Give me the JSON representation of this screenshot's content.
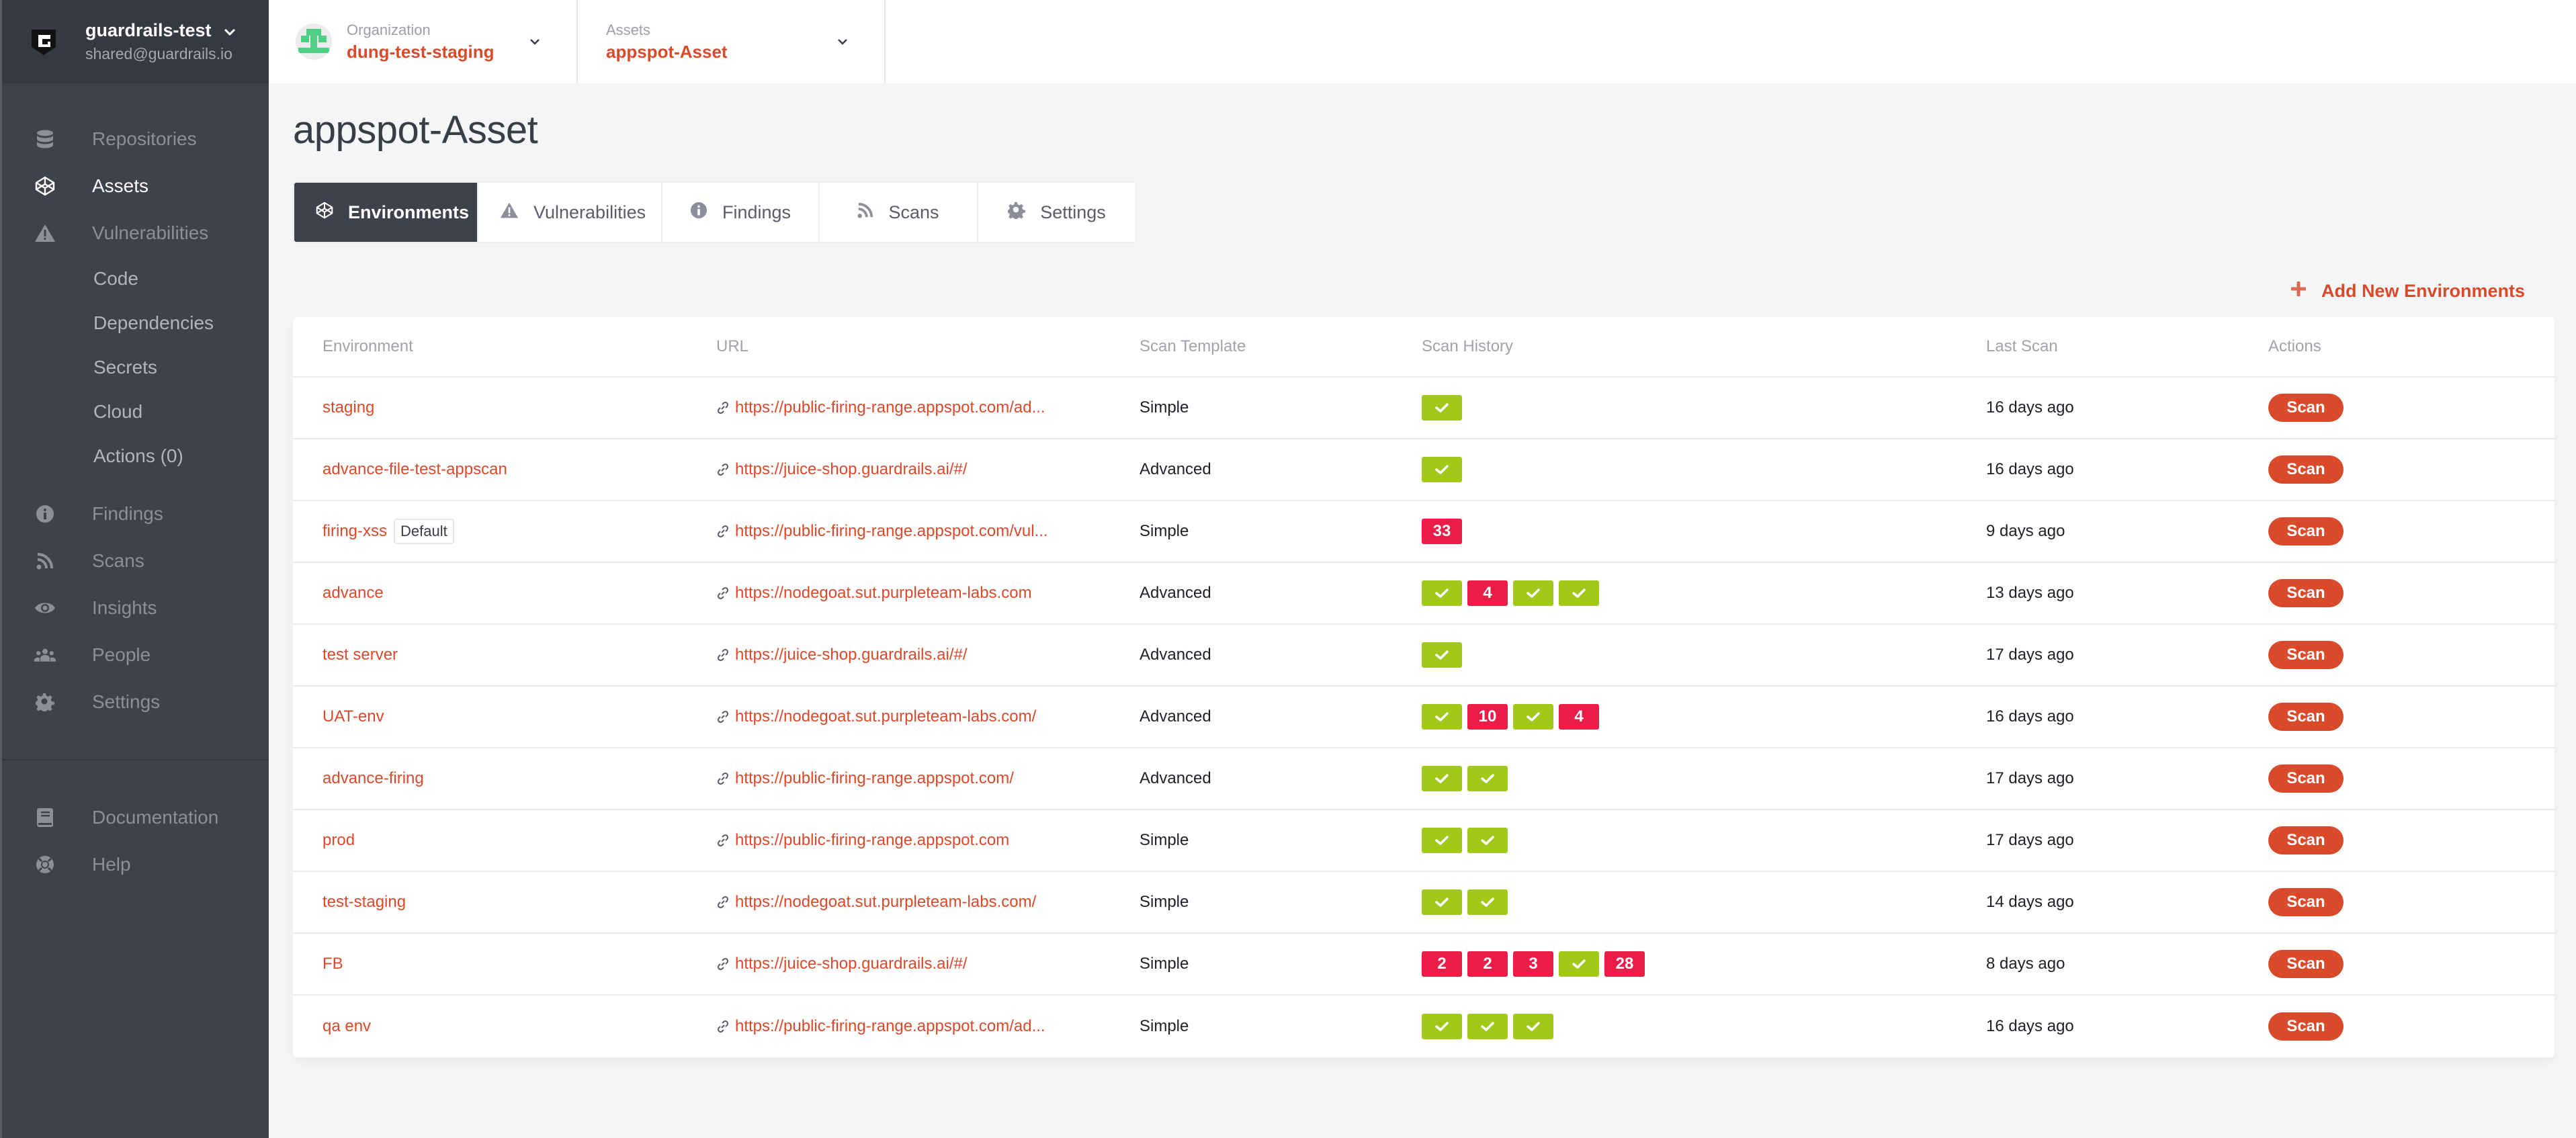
{
  "account": {
    "name": "guardrails-test",
    "email": "shared@guardrails.io"
  },
  "sidebar": {
    "items": [
      {
        "label": "Repositories",
        "icon": "database-icon",
        "active": false
      },
      {
        "label": "Assets",
        "icon": "cube-icon",
        "active": true
      },
      {
        "label": "Vulnerabilities",
        "icon": "warning-icon",
        "active": false
      }
    ],
    "subitems": [
      "Code",
      "Dependencies",
      "Secrets",
      "Cloud",
      "Actions (0)"
    ],
    "items2": [
      {
        "label": "Findings",
        "icon": "info-icon"
      },
      {
        "label": "Scans",
        "icon": "rss-icon"
      },
      {
        "label": "Insights",
        "icon": "eye-icon"
      },
      {
        "label": "People",
        "icon": "users-icon"
      },
      {
        "label": "Settings",
        "icon": "gear-icon"
      }
    ],
    "footer": [
      {
        "label": "Documentation",
        "icon": "book-icon"
      },
      {
        "label": "Help",
        "icon": "lifebuoy-icon"
      }
    ]
  },
  "topbar": {
    "organization": {
      "label": "Organization",
      "value": "dung-test-staging"
    },
    "asset": {
      "label": "Assets",
      "value": "appspot-Asset"
    }
  },
  "page": {
    "title": "appspot-Asset"
  },
  "tabs": [
    {
      "label": "Environments",
      "icon": "cube-icon",
      "active": true
    },
    {
      "label": "Vulnerabilities",
      "icon": "warning-icon"
    },
    {
      "label": "Findings",
      "icon": "info-icon"
    },
    {
      "label": "Scans",
      "icon": "rss-icon"
    },
    {
      "label": "Settings",
      "icon": "gear-icon"
    }
  ],
  "add_button": {
    "label": "Add New Environments"
  },
  "table": {
    "headers": [
      "Environment",
      "URL",
      "Scan Template",
      "Scan History",
      "Last Scan",
      "Actions"
    ],
    "rows": [
      {
        "env": "staging",
        "url": "https://public-firing-range.appspot.com/ad...",
        "template": "Simple",
        "history": [
          "pass"
        ],
        "last": "16 days ago",
        "action": "Scan"
      },
      {
        "env": "advance-file-test-appscan",
        "url": "https://juice-shop.guardrails.ai/#/",
        "template": "Advanced",
        "history": [
          "pass"
        ],
        "last": "16 days ago",
        "action": "Scan"
      },
      {
        "env": "firing-xss",
        "badge": "Default",
        "url": "https://public-firing-range.appspot.com/vul...",
        "template": "Simple",
        "history": [
          "33"
        ],
        "last": "9 days ago",
        "action": "Scan"
      },
      {
        "env": "advance",
        "url": "https://nodegoat.sut.purpleteam-labs.com",
        "template": "Advanced",
        "history": [
          "pass",
          "4",
          "pass",
          "pass"
        ],
        "last": "13 days ago",
        "action": "Scan"
      },
      {
        "env": "test server",
        "url": "https://juice-shop.guardrails.ai/#/",
        "template": "Advanced",
        "history": [
          "pass"
        ],
        "last": "17 days ago",
        "action": "Scan"
      },
      {
        "env": "UAT-env",
        "url": "https://nodegoat.sut.purpleteam-labs.com/",
        "template": "Advanced",
        "history": [
          "pass",
          "10",
          "pass",
          "4"
        ],
        "last": "16 days ago",
        "action": "Scan"
      },
      {
        "env": "advance-firing",
        "url": "https://public-firing-range.appspot.com/",
        "template": "Advanced",
        "history": [
          "pass",
          "pass"
        ],
        "last": "17 days ago",
        "action": "Scan"
      },
      {
        "env": "prod",
        "url": "https://public-firing-range.appspot.com",
        "template": "Simple",
        "history": [
          "pass",
          "pass"
        ],
        "last": "17 days ago",
        "action": "Scan"
      },
      {
        "env": "test-staging",
        "url": "https://nodegoat.sut.purpleteam-labs.com/",
        "template": "Simple",
        "history": [
          "pass",
          "pass"
        ],
        "last": "14 days ago",
        "action": "Scan"
      },
      {
        "env": "FB",
        "url": "https://juice-shop.guardrails.ai/#/",
        "template": "Simple",
        "history": [
          "2",
          "2",
          "3",
          "pass",
          "28"
        ],
        "last": "8 days ago",
        "action": "Scan"
      },
      {
        "env": "qa env",
        "url": "https://public-firing-range.appspot.com/ad...",
        "template": "Simple",
        "history": [
          "pass",
          "pass",
          "pass"
        ],
        "last": "16 days ago",
        "action": "Scan"
      }
    ]
  },
  "colors": {
    "accent": "#d94a2b",
    "pass": "#a2c81a",
    "fail": "#ea1c48",
    "sidebar": "#3f414c"
  }
}
